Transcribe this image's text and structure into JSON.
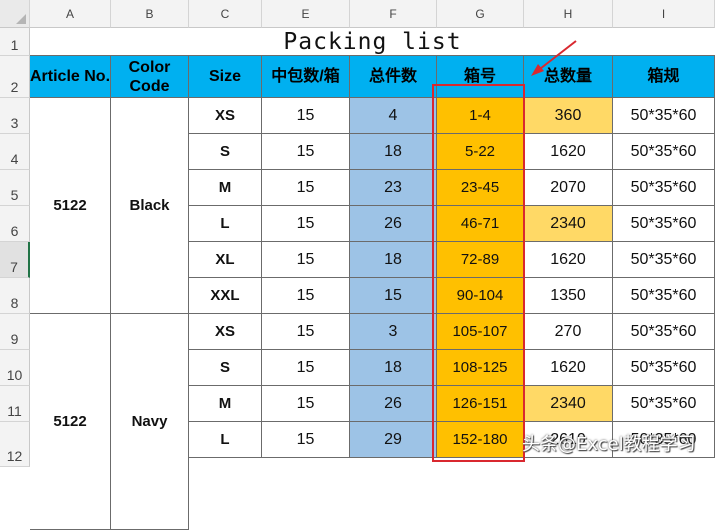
{
  "title": "Packing list",
  "columns": [
    "A",
    "B",
    "C",
    "E",
    "F",
    "G",
    "H",
    "I"
  ],
  "rows": [
    "1",
    "2",
    "3",
    "4",
    "5",
    "6",
    "7",
    "8",
    "9",
    "10",
    "11",
    "12"
  ],
  "headers": {
    "article": "Article No.",
    "color": "Color Code",
    "size": "Size",
    "per_box": "中包数/箱",
    "total_pieces": "总件数",
    "box_no": "箱号",
    "total_qty": "总数量",
    "box_spec": "箱规"
  },
  "groups": [
    {
      "article": "5122",
      "color": "Black"
    },
    {
      "article": "5122",
      "color": "Navy"
    }
  ],
  "data_rows": [
    {
      "size": "XS",
      "per_box": "15",
      "pieces": "4",
      "box_no": "1-4",
      "qty": "360",
      "spec": "50*35*60"
    },
    {
      "size": "S",
      "per_box": "15",
      "pieces": "18",
      "box_no": "5-22",
      "qty": "1620",
      "spec": "50*35*60"
    },
    {
      "size": "M",
      "per_box": "15",
      "pieces": "23",
      "box_no": "23-45",
      "qty": "2070",
      "spec": "50*35*60"
    },
    {
      "size": "L",
      "per_box": "15",
      "pieces": "26",
      "box_no": "46-71",
      "qty": "2340",
      "spec": "50*35*60"
    },
    {
      "size": "XL",
      "per_box": "15",
      "pieces": "18",
      "box_no": "72-89",
      "qty": "1620",
      "spec": "50*35*60"
    },
    {
      "size": "XXL",
      "per_box": "15",
      "pieces": "15",
      "box_no": "90-104",
      "qty": "1350",
      "spec": "50*35*60"
    },
    {
      "size": "XS",
      "per_box": "15",
      "pieces": "3",
      "box_no": "105-107",
      "qty": "270",
      "spec": "50*35*60"
    },
    {
      "size": "S",
      "per_box": "15",
      "pieces": "18",
      "box_no": "108-125",
      "qty": "1620",
      "spec": "50*35*60"
    },
    {
      "size": "M",
      "per_box": "15",
      "pieces": "26",
      "box_no": "126-151",
      "qty": "2340",
      "spec": "50*35*60"
    },
    {
      "size": "L",
      "per_box": "15",
      "pieces": "29",
      "box_no": "152-180",
      "qty": "2610",
      "spec": "50*35*60"
    }
  ],
  "watermark": "头条@Excel教程学习",
  "colors": {
    "header_bg": "#00b0f0",
    "pieces_bg": "#9dc3e6",
    "box_no_bg": "#ffc000",
    "qty_highlight": "#ffd966",
    "annotation": "#d9282f"
  }
}
